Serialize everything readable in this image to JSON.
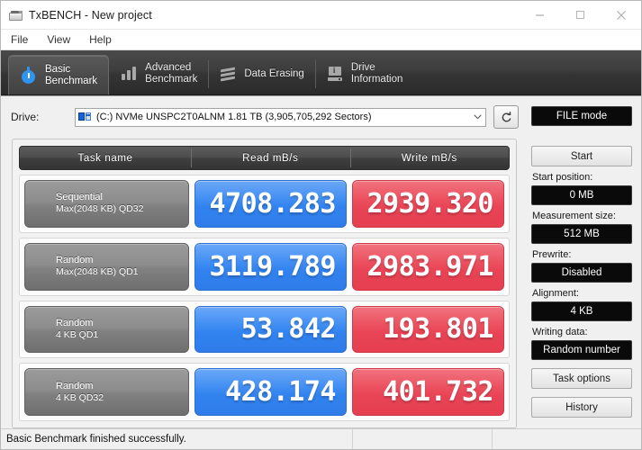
{
  "window": {
    "title": "TxBENCH - New project",
    "icon": "drive-app-icon",
    "minimize": "minimize-icon",
    "maximize": "maximize-icon",
    "close": "close-icon"
  },
  "menu": {
    "items": [
      {
        "label": "File"
      },
      {
        "label": "View"
      },
      {
        "label": "Help"
      }
    ]
  },
  "tabs": [
    {
      "line1": "Basic",
      "line2": "Benchmark",
      "icon": "stopwatch-icon",
      "active": true
    },
    {
      "line1": "Advanced",
      "line2": "Benchmark",
      "icon": "bar-chart-icon",
      "active": false
    },
    {
      "line1": "Data Erasing",
      "line2": "",
      "icon": "erase-wave-icon",
      "active": false
    },
    {
      "line1": "Drive",
      "line2": "Information",
      "icon": "drive-info-icon",
      "active": false
    }
  ],
  "drive": {
    "label": "Drive:",
    "selected": "(C:) NVMe UNSPC2T0ALNM  1.81 TB (3,905,705,292 Sectors)",
    "dropdown_icon": "chevron-down-icon",
    "refresh_icon": "refresh-icon"
  },
  "table": {
    "headers": {
      "task": "Task name",
      "read": "Read mB/s",
      "write": "Write mB/s"
    },
    "rows": [
      {
        "task_l1": "Sequential",
        "task_l2": "Max(2048 KB) QD32",
        "read": "4708.283",
        "write": "2939.320"
      },
      {
        "task_l1": "Random",
        "task_l2": "Max(2048 KB) QD1",
        "read": "3119.789",
        "write": "2983.971"
      },
      {
        "task_l1": "Random",
        "task_l2": "4 KB QD1",
        "read": "53.842",
        "write": "193.801"
      },
      {
        "task_l1": "Random",
        "task_l2": "4 KB QD32",
        "read": "428.174",
        "write": "401.732"
      }
    ]
  },
  "sidebar": {
    "mode_button": "FILE mode",
    "start_button": "Start",
    "start_position_label": "Start position:",
    "start_position_value": "0 MB",
    "measurement_size_label": "Measurement size:",
    "measurement_size_value": "512 MB",
    "prewrite_label": "Prewrite:",
    "prewrite_value": "Disabled",
    "alignment_label": "Alignment:",
    "alignment_value": "4 KB",
    "writing_data_label": "Writing data:",
    "writing_data_value": "Random number",
    "task_options_button": "Task options",
    "history_button": "History"
  },
  "status": {
    "message": "Basic Benchmark finished successfully.",
    "pane2": "",
    "pane3": ""
  },
  "colors": {
    "read": "#3182ef",
    "write": "#e84456",
    "toolbar": "#3d3d3d",
    "task_cell": "#808080"
  },
  "chart_data": {
    "type": "bar",
    "title": "TxBENCH Basic Benchmark",
    "categories": [
      "Sequential Max(2048 KB) QD32",
      "Random Max(2048 KB) QD1",
      "Random 4 KB QD1",
      "Random 4 KB QD32"
    ],
    "series": [
      {
        "name": "Read mB/s",
        "values": [
          4708.283,
          3119.789,
          53.842,
          428.174
        ]
      },
      {
        "name": "Write mB/s",
        "values": [
          2939.32,
          2983.971,
          193.801,
          401.732
        ]
      }
    ],
    "xlabel": "Task name",
    "ylabel": "mB/s",
    "legend": "top"
  }
}
